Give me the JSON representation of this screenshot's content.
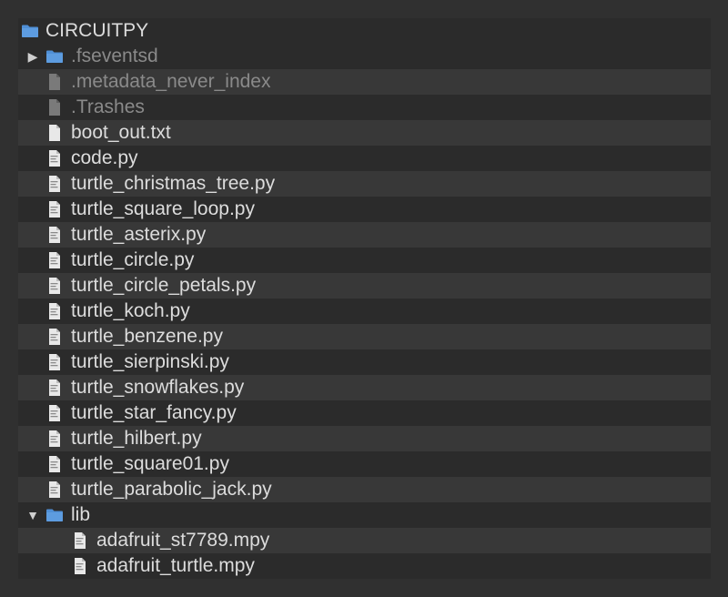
{
  "tree": {
    "root": {
      "label": "CIRCUITPY",
      "icon": "folder-icon"
    },
    "items": [
      {
        "label": ".fseventsd",
        "icon": "folder-icon",
        "disclosure": "collapsed",
        "hidden": true,
        "depth": 1
      },
      {
        "label": ".metadata_never_index",
        "icon": "generic-file-icon",
        "hidden": true,
        "depth": 1
      },
      {
        "label": ".Trashes",
        "icon": "generic-file-icon",
        "hidden": true,
        "depth": 1
      },
      {
        "label": "boot_out.txt",
        "icon": "text-file-icon",
        "depth": 1
      },
      {
        "label": "code.py",
        "icon": "python-file-icon",
        "depth": 1
      },
      {
        "label": "turtle_christmas_tree.py",
        "icon": "python-file-icon",
        "depth": 1
      },
      {
        "label": "turtle_square_loop.py",
        "icon": "python-file-icon",
        "depth": 1
      },
      {
        "label": "turtle_asterix.py",
        "icon": "python-file-icon",
        "depth": 1
      },
      {
        "label": "turtle_circle.py",
        "icon": "python-file-icon",
        "depth": 1
      },
      {
        "label": "turtle_circle_petals.py",
        "icon": "python-file-icon",
        "depth": 1
      },
      {
        "label": "turtle_koch.py",
        "icon": "python-file-icon",
        "depth": 1
      },
      {
        "label": "turtle_benzene.py",
        "icon": "python-file-icon",
        "depth": 1
      },
      {
        "label": "turtle_sierpinski.py",
        "icon": "python-file-icon",
        "depth": 1
      },
      {
        "label": "turtle_snowflakes.py",
        "icon": "python-file-icon",
        "depth": 1
      },
      {
        "label": "turtle_star_fancy.py",
        "icon": "python-file-icon",
        "depth": 1
      },
      {
        "label": "turtle_hilbert.py",
        "icon": "python-file-icon",
        "depth": 1
      },
      {
        "label": "turtle_square01.py",
        "icon": "python-file-icon",
        "depth": 1
      },
      {
        "label": "turtle_parabolic_jack.py",
        "icon": "python-file-icon",
        "depth": 1
      },
      {
        "label": "lib",
        "icon": "folder-icon",
        "disclosure": "expanded",
        "depth": 1
      },
      {
        "label": "adafruit_st7789.mpy",
        "icon": "python-file-icon",
        "depth": 2
      },
      {
        "label": "adafruit_turtle.mpy",
        "icon": "python-file-icon",
        "depth": 2
      }
    ]
  },
  "colors": {
    "background": "#303030",
    "panel": "#2b2b2b",
    "stripe": "#383838",
    "text": "#dcdcdc",
    "hidden_text": "#8a8a8a",
    "folder": "#4f8fd6"
  }
}
